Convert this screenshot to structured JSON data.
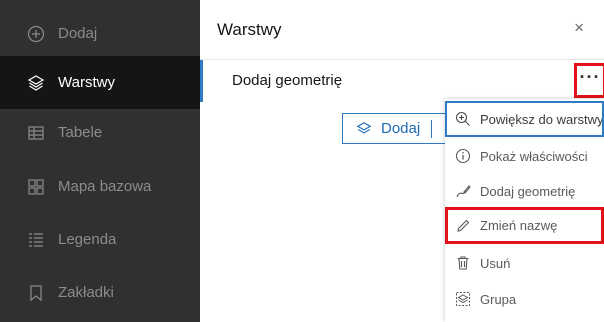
{
  "sidebar": {
    "items": [
      {
        "label": "Dodaj",
        "icon": "plus-circle-icon"
      },
      {
        "label": "Warstwy",
        "icon": "layers-icon",
        "active": true
      },
      {
        "label": "Tabele",
        "icon": "table-icon"
      },
      {
        "label": "Mapa bazowa",
        "icon": "basemap-grid-icon"
      },
      {
        "label": "Legenda",
        "icon": "legend-list-icon"
      },
      {
        "label": "Zakładki",
        "icon": "bookmark-icon"
      }
    ]
  },
  "panel": {
    "title": "Warstwy",
    "close_glyph": "×",
    "layer": {
      "label": "Dodaj geometrię",
      "more_glyph": "···"
    },
    "add_button": {
      "label": "Dodaj"
    }
  },
  "menu": {
    "items": [
      {
        "label": "Powiększ do warstwy",
        "icon": "zoom-in-icon"
      },
      {
        "label": "Pokaż właściwości",
        "icon": "info-icon"
      },
      {
        "label": "Dodaj geometrię",
        "icon": "sketch-icon"
      },
      {
        "label": "Zmień nazwę",
        "icon": "pencil-icon"
      },
      {
        "label": "Usuń",
        "icon": "trash-icon"
      },
      {
        "label": "Grupa",
        "icon": "group-icon"
      }
    ]
  },
  "colors": {
    "sidebar_bg": "#303030",
    "sidebar_active_bg": "#151515",
    "accent_blue": "#2f7bc4",
    "highlight_red": "#e0131a"
  }
}
